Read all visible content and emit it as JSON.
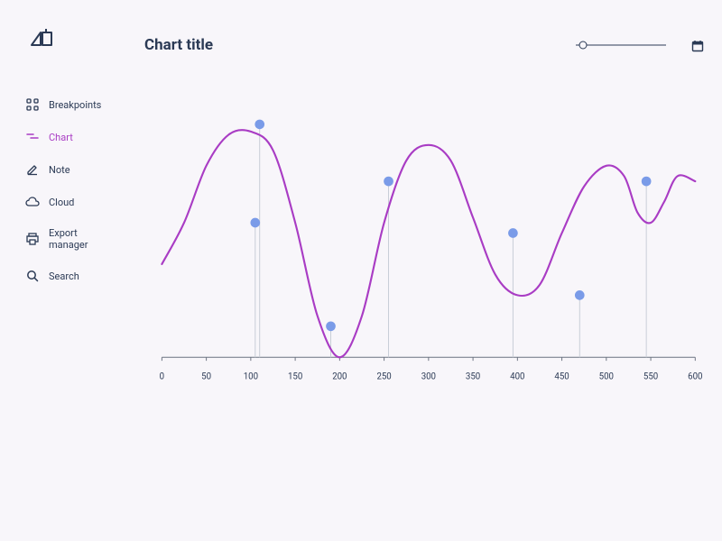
{
  "sidebar": {
    "items": [
      {
        "label": "Breakpoints"
      },
      {
        "label": "Chart"
      },
      {
        "label": "Note"
      },
      {
        "label": "Cloud"
      },
      {
        "label": "Export manager"
      },
      {
        "label": "Search"
      }
    ],
    "active_index": 1
  },
  "header": {
    "title": "Chart title"
  },
  "colors": {
    "line": "#a93cc4",
    "marker_fill": "#7a9be8",
    "axis": "#6b7280",
    "tick_text": "#2b3a55"
  },
  "chart_data": {
    "type": "line",
    "title": "Chart title",
    "xlabel": "",
    "ylabel": "",
    "xlim": [
      0,
      600
    ],
    "x_ticks": [
      0,
      50,
      100,
      150,
      200,
      250,
      300,
      350,
      400,
      450,
      500,
      550,
      600
    ],
    "curve": [
      {
        "x": 0,
        "y": 90
      },
      {
        "x": 25,
        "y": 130
      },
      {
        "x": 50,
        "y": 185
      },
      {
        "x": 75,
        "y": 215
      },
      {
        "x": 100,
        "y": 218
      },
      {
        "x": 125,
        "y": 200
      },
      {
        "x": 150,
        "y": 130
      },
      {
        "x": 175,
        "y": 40
      },
      {
        "x": 200,
        "y": 0
      },
      {
        "x": 225,
        "y": 40
      },
      {
        "x": 250,
        "y": 130
      },
      {
        "x": 275,
        "y": 190
      },
      {
        "x": 300,
        "y": 205
      },
      {
        "x": 325,
        "y": 190
      },
      {
        "x": 350,
        "y": 135
      },
      {
        "x": 375,
        "y": 80
      },
      {
        "x": 400,
        "y": 60
      },
      {
        "x": 425,
        "y": 70
      },
      {
        "x": 450,
        "y": 120
      },
      {
        "x": 475,
        "y": 165
      },
      {
        "x": 500,
        "y": 185
      },
      {
        "x": 520,
        "y": 175
      },
      {
        "x": 535,
        "y": 140
      },
      {
        "x": 550,
        "y": 130
      },
      {
        "x": 565,
        "y": 150
      },
      {
        "x": 580,
        "y": 175
      },
      {
        "x": 600,
        "y": 170
      }
    ],
    "markers": [
      {
        "x": 105,
        "y": 130
      },
      {
        "x": 110,
        "y": 225
      },
      {
        "x": 190,
        "y": 30
      },
      {
        "x": 255,
        "y": 170
      },
      {
        "x": 395,
        "y": 120
      },
      {
        "x": 470,
        "y": 60
      },
      {
        "x": 545,
        "y": 170
      }
    ],
    "y_range_note": "y=0 is chart baseline; values are relative heights above baseline in plot units"
  }
}
